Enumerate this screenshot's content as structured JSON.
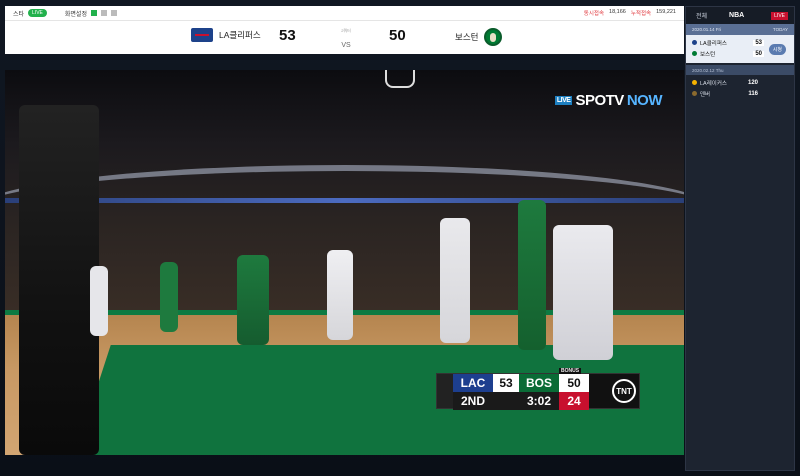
{
  "topbar": {
    "mode_label": "스타",
    "live_badge": "LIVE",
    "settings_label": "화면설정",
    "right_items": [
      "동시접속",
      "18,166",
      "누적접속",
      "159,221"
    ]
  },
  "scoreboard": {
    "home_name": "LA클리퍼스",
    "home_score": "53",
    "period_label": "2쿼터",
    "vs": "VS",
    "away_score": "50",
    "away_name": "보스턴"
  },
  "video": {
    "broadcaster_live": "LIVE",
    "broadcaster_name": "SPOTV",
    "broadcaster_now": "NOW"
  },
  "score_bug": {
    "team1": "LAC",
    "score1": "53",
    "team2": "BOS",
    "score2": "50",
    "bonus": "BONUS",
    "quarter": "2ND",
    "clock": "3:02",
    "shot_clock": "24",
    "network": "TNT"
  },
  "sidebar": {
    "tab_all": "전체",
    "tab_league": "NBA",
    "tab_badge": "LIVE",
    "dates": [
      {
        "date": "2020.01.14 Fri",
        "today": "TODAY"
      },
      {
        "date": "2020.02.12 Thu"
      }
    ],
    "game1": {
      "team1": "LA클리퍼스",
      "score1": "53",
      "team2": "보스턴",
      "score2": "50",
      "button": "시청"
    },
    "game2": {
      "team1": "LA레이커스",
      "score1": "120",
      "team2": "덴버",
      "score2": "116"
    }
  },
  "colors": {
    "clippers_blue": "#1d428a",
    "clippers_red": "#c8102e",
    "celtics_green": "#007a33",
    "live_green": "#22b14c",
    "sidebar_bg": "#1d2430"
  }
}
